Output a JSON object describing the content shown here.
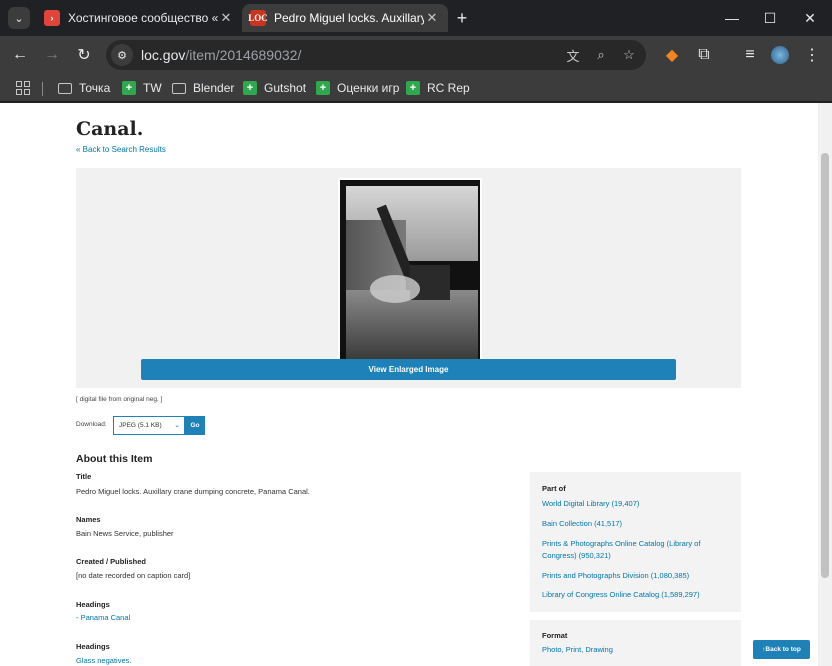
{
  "browser": {
    "tabs": [
      {
        "title": "Хостинговое сообщество «Tim",
        "favicon": "youtube-like-red-icon"
      },
      {
        "title": "Pedro Miguel locks. Auxillary cr",
        "favicon": "loc-logo-icon",
        "favicon_text": "LOC"
      }
    ],
    "url_host": "loc.gov",
    "url_path": "/item/2014689032/",
    "bookmarks": [
      {
        "label": "Точка",
        "icon": "folder-icon"
      },
      {
        "label": "TW",
        "icon": "green-bookmark-icon"
      },
      {
        "label": "Blender",
        "icon": "folder-icon"
      },
      {
        "label": "Gutshot",
        "icon": "green-bookmark-icon"
      },
      {
        "label": "Оценки игр",
        "icon": "green-bookmark-icon"
      },
      {
        "label": "RC Rep",
        "icon": "green-bookmark-icon"
      }
    ]
  },
  "page": {
    "title_line2": "Canal.",
    "back_link": "« Back to Search Results",
    "view_enlarged": "View Enlarged Image",
    "caption": "[ digital file from original neg. ]",
    "download_label": "Download:",
    "download_option": "JPEG (5.1 KB)",
    "download_go": "Go",
    "about_heading": "About this Item",
    "fields": [
      {
        "heading": "Title",
        "value": "Pedro Miguel locks. Auxillary crane dumping concrete, Panama Canal."
      },
      {
        "heading": "Names",
        "value": "Bain News Service, publisher"
      },
      {
        "heading": "Created / Published",
        "value": "[no date recorded on caption card]"
      },
      {
        "heading": "Headings",
        "value": "-  Panama Canal"
      },
      {
        "heading": "Headings",
        "value": "Glass negatives."
      }
    ],
    "part_of_heading": "Part of",
    "part_of": [
      "World Digital Library (19,407)",
      "Bain Collection (41,517)",
      "Prints & Photographs Online Catalog (Library of Congress) (950,321)",
      "Prints and Photographs Division (1,080,385)",
      "Library of Congress Online Catalog (1,589,297)"
    ],
    "format_heading": "Format",
    "format_value": "Photo, Print, Drawing",
    "back_to_top": "Back to top"
  },
  "colors": {
    "link": "#0076ad",
    "button": "#1e81b8"
  }
}
